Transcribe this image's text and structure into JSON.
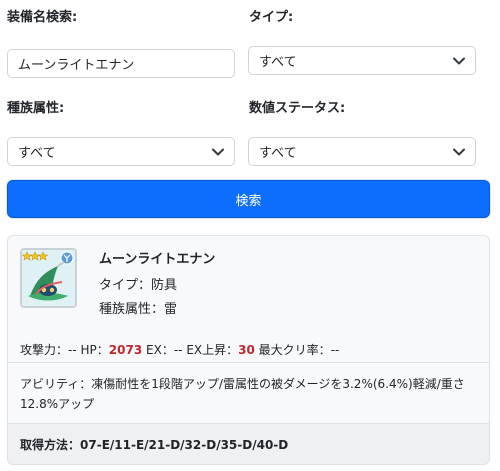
{
  "filters": {
    "equip_name_label": "装備名検索:",
    "equip_name_value": "ムーンライトエナン",
    "type_label": "タイプ:",
    "type_value": "すべて",
    "race_label": "種族属性:",
    "race_value": "すべて",
    "stat_label": "数値ステータス:",
    "stat_value": "すべて"
  },
  "search_button": "検索",
  "result": {
    "rarity_stars": 3,
    "name": "ムーンライトエナン",
    "type": "タイプ：防具",
    "race": "種族属性：雷",
    "stats": {
      "attack_label": "攻撃力：",
      "attack_value": "--",
      "hp_label": "HP：",
      "hp_value": "2073",
      "ex_label": "EX：",
      "ex_value": "--",
      "ex_up_label": "EX上昇：",
      "ex_up_value": "30",
      "crit_label": "最大クリ率：",
      "crit_value": "--"
    },
    "ability": "アビリティ：凍傷耐性を1段階アップ/雷属性の被ダメージを3.2%(6.4%)軽減/重さ12.8%アップ",
    "acquisition_label": "取得方法：",
    "acquisition_value": "07-E/11-E/21-D/32-D/35-D/40-D"
  },
  "colors": {
    "primary": "#0d6efd",
    "highlight_red": "#c0272d",
    "card_bg": "#f8f9fa"
  }
}
